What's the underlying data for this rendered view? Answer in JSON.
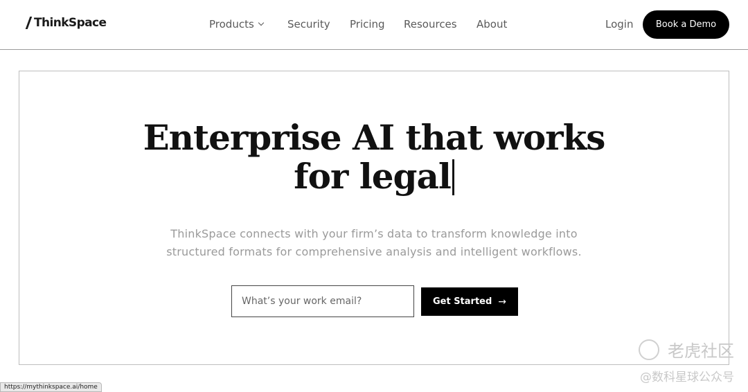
{
  "header": {
    "logo_text": "ThinkSpace",
    "nav": [
      {
        "label": "Products",
        "has_dropdown": true
      },
      {
        "label": "Security"
      },
      {
        "label": "Pricing"
      },
      {
        "label": "Resources"
      },
      {
        "label": "About"
      }
    ],
    "login_label": "Login",
    "demo_label": "Book a Demo"
  },
  "hero": {
    "headline_line1": "Enterprise AI that works",
    "headline_line2": "for legal",
    "subtext_line1": "ThinkSpace connects with your firm’s data to transform knowledge into",
    "subtext_line2": "structured formats for comprehensive analysis and intelligent workflows.",
    "email_placeholder": "What’s your work email?",
    "cta_label": "Get Started",
    "cta_icon": "arrow-right-icon"
  },
  "status_url": "https://mythinkspace.ai/home",
  "watermark": {
    "line1": "老虎社区",
    "line2": "@数科星球公众号"
  },
  "colors": {
    "primary": "#000000",
    "muted_text": "#9a9a9a",
    "nav_text": "#5a5a5a",
    "border": "#bdbdbd"
  }
}
